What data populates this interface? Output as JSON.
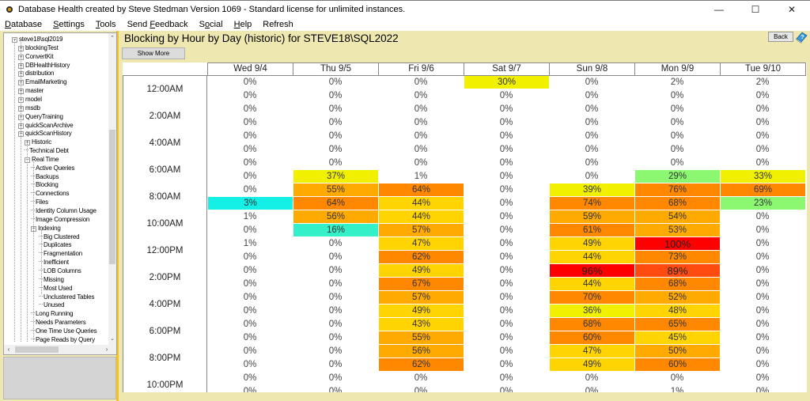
{
  "window": {
    "title": "Database Health created by Steve Stedman Version 1069 - Standard license for unlimited instances.",
    "controls": {
      "minimize": "—",
      "maximize": "☐",
      "close": "✕"
    }
  },
  "menu": [
    {
      "label": "Database",
      "accel": "D"
    },
    {
      "label": "Settings",
      "accel": "S"
    },
    {
      "label": "Tools",
      "accel": "T"
    },
    {
      "label": "Send Feedback",
      "accel": "F"
    },
    {
      "label": "Social",
      "accel": "o"
    },
    {
      "label": "Help",
      "accel": "H"
    },
    {
      "label": "Refresh",
      "accel": ""
    }
  ],
  "tree": {
    "items": [
      {
        "label": "steve18\\sql2019",
        "level": 0,
        "expander": "minus"
      },
      {
        "label": "blockingTest",
        "level": 1,
        "expander": "plus"
      },
      {
        "label": "ConvertKit",
        "level": 1,
        "expander": "plus"
      },
      {
        "label": "DBHealthHistory",
        "level": 1,
        "expander": "plus"
      },
      {
        "label": "distribution",
        "level": 1,
        "expander": "plus"
      },
      {
        "label": "EmailMarketing",
        "level": 1,
        "expander": "plus"
      },
      {
        "label": "master",
        "level": 1,
        "expander": "plus"
      },
      {
        "label": "model",
        "level": 1,
        "expander": "plus"
      },
      {
        "label": "msdb",
        "level": 1,
        "expander": "plus"
      },
      {
        "label": "QueryTraining",
        "level": 1,
        "expander": "plus"
      },
      {
        "label": "quickScanArchive",
        "level": 1,
        "expander": "plus"
      },
      {
        "label": "quickScanHistory",
        "level": 1,
        "expander": "minus"
      },
      {
        "label": "Historic",
        "level": 2,
        "expander": "plus"
      },
      {
        "label": "Technical Debt",
        "level": 2,
        "expander": "none"
      },
      {
        "label": "Real Time",
        "level": 2,
        "expander": "minus"
      },
      {
        "label": "Active Queries",
        "level": 3,
        "expander": "none"
      },
      {
        "label": "Backups",
        "level": 3,
        "expander": "none"
      },
      {
        "label": "Blocking",
        "level": 3,
        "expander": "none"
      },
      {
        "label": "Connections",
        "level": 3,
        "expander": "none"
      },
      {
        "label": "Files",
        "level": 3,
        "expander": "none"
      },
      {
        "label": "Identity Column Usage",
        "level": 3,
        "expander": "none"
      },
      {
        "label": "Image Compression",
        "level": 3,
        "expander": "none"
      },
      {
        "label": "Indexing",
        "level": 3,
        "expander": "minus"
      },
      {
        "label": "Big Clustered",
        "level": 4,
        "expander": "none"
      },
      {
        "label": "Duplicates",
        "level": 4,
        "expander": "none"
      },
      {
        "label": "Fragmentation",
        "level": 4,
        "expander": "none"
      },
      {
        "label": "Inefficient",
        "level": 4,
        "expander": "none"
      },
      {
        "label": "LOB Columns",
        "level": 4,
        "expander": "none"
      },
      {
        "label": "Missing",
        "level": 4,
        "expander": "none"
      },
      {
        "label": "Most Used",
        "level": 4,
        "expander": "none"
      },
      {
        "label": "Unclustered Tables",
        "level": 4,
        "expander": "none"
      },
      {
        "label": "Unused",
        "level": 4,
        "expander": "none"
      },
      {
        "label": "Long Running",
        "level": 3,
        "expander": "none"
      },
      {
        "label": "Needs Parameters",
        "level": 3,
        "expander": "none"
      },
      {
        "label": "One Time Use Queries",
        "level": 3,
        "expander": "none"
      },
      {
        "label": "Page Reads by Query",
        "level": 3,
        "expander": "none"
      }
    ]
  },
  "report": {
    "title": "Blocking by Hour by Day (historic) for STEVE18\\SQL2022",
    "show_more_label": "Show More",
    "back_label": "Back",
    "days": [
      "Wed 9/4",
      "Thu 9/5",
      "Fri 9/6",
      "Sat 9/7",
      "Sun 9/8",
      "Mon 9/9",
      "Tue 9/10"
    ],
    "time_labels": [
      "12:00AM",
      "2:00AM",
      "4:00AM",
      "6:00AM",
      "8:00AM",
      "10:00AM",
      "12:00PM",
      "2:00PM",
      "4:00PM",
      "6:00PM",
      "8:00PM",
      "10:00PM"
    ],
    "rows": [
      [
        0,
        0,
        0,
        30,
        0,
        2,
        2
      ],
      [
        0,
        0,
        0,
        0,
        0,
        0,
        0
      ],
      [
        0,
        0,
        0,
        0,
        0,
        0,
        0
      ],
      [
        0,
        0,
        0,
        0,
        0,
        0,
        0
      ],
      [
        0,
        0,
        0,
        0,
        0,
        0,
        0
      ],
      [
        0,
        0,
        0,
        0,
        0,
        0,
        0
      ],
      [
        0,
        0,
        0,
        0,
        0,
        0,
        0
      ],
      [
        0,
        37,
        1,
        0,
        0,
        29,
        33
      ],
      [
        0,
        55,
        64,
        0,
        39,
        76,
        69
      ],
      [
        3,
        64,
        44,
        0,
        74,
        68,
        23
      ],
      [
        1,
        56,
        44,
        0,
        59,
        54,
        0
      ],
      [
        0,
        16,
        57,
        0,
        61,
        53,
        0
      ],
      [
        1,
        0,
        47,
        0,
        49,
        100,
        0
      ],
      [
        0,
        0,
        62,
        0,
        44,
        73,
        0
      ],
      [
        0,
        0,
        49,
        0,
        96,
        89,
        0
      ],
      [
        0,
        0,
        67,
        0,
        44,
        68,
        0
      ],
      [
        0,
        0,
        57,
        0,
        70,
        52,
        0
      ],
      [
        0,
        0,
        49,
        0,
        36,
        48,
        0
      ],
      [
        0,
        0,
        43,
        0,
        68,
        65,
        0
      ],
      [
        0,
        0,
        55,
        0,
        60,
        45,
        0
      ],
      [
        0,
        0,
        56,
        0,
        47,
        50,
        0
      ],
      [
        0,
        0,
        62,
        0,
        49,
        60,
        0
      ],
      [
        0,
        0,
        0,
        0,
        0,
        0,
        0
      ],
      [
        0,
        0,
        0,
        0,
        0,
        1,
        0
      ]
    ],
    "special_colors": {
      "9,0": "#14f0e6",
      "11,1": "#33f0c8",
      "7,5": "#8cf872",
      "9,6": "#8cf872"
    },
    "color_scale": {
      "yellow": "#f0f000",
      "gold": "#ffd400",
      "orange_light": "#ffaa00",
      "orange": "#ff8800",
      "orange_red": "#ff4a10",
      "red": "#ff0000"
    }
  }
}
